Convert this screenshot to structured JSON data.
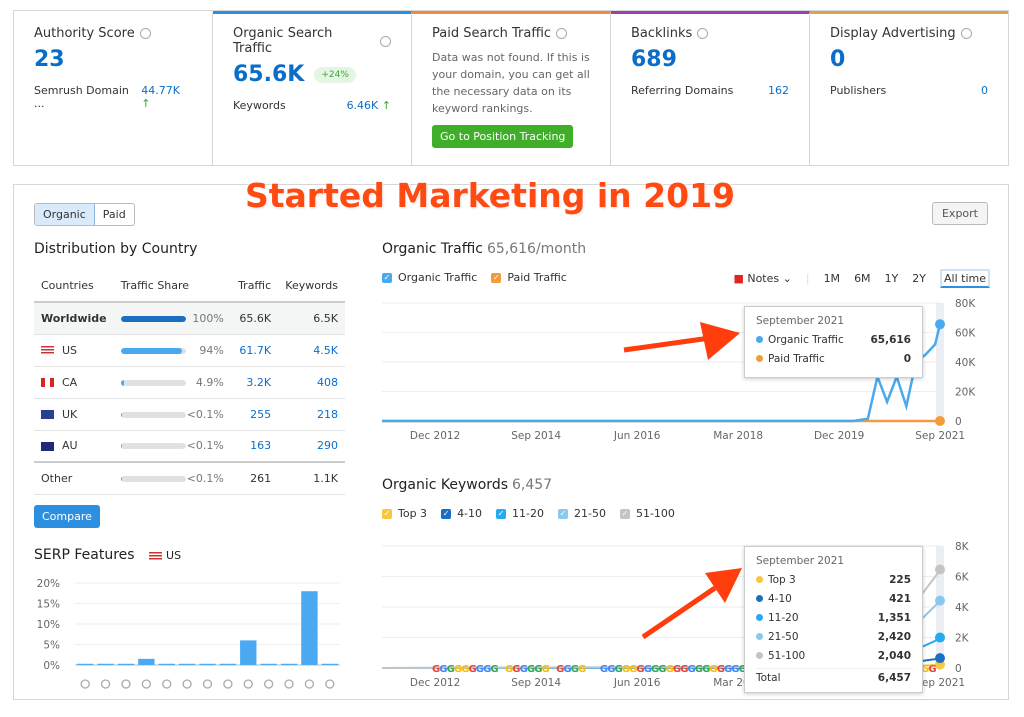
{
  "cards": [
    {
      "title": "Authority Score",
      "value": "23",
      "sub_label": "Semrush Domain ...",
      "sub_value": "44.77K",
      "accent": ""
    },
    {
      "title": "Organic Search Traffic",
      "value": "65.6K",
      "badge": "+24%",
      "sub_label": "Keywords",
      "sub_value": "6.46K",
      "accent": "#2d8fe0"
    },
    {
      "title": "Paid Search Traffic",
      "text": "Data was not found. If this is your domain, you can get all the necessary data on its keyword rankings.",
      "button": "Go to Position Tracking",
      "accent": "#f08a3c"
    },
    {
      "title": "Backlinks",
      "value": "689",
      "sub_label": "Referring Domains",
      "sub_value": "162",
      "accent": "#9b3fb5"
    },
    {
      "title": "Display Advertising",
      "value": "0",
      "sub_label": "Publishers",
      "sub_value": "0",
      "accent": "#d9a54a"
    }
  ],
  "headline": "Started Marketing in 2019",
  "toggle": {
    "organic": "Organic",
    "paid": "Paid"
  },
  "export_label": "Export",
  "distribution": {
    "title": "Distribution by Country",
    "headers": [
      "Countries",
      "Traffic Share",
      "Traffic",
      "Keywords"
    ],
    "rows": [
      {
        "country": "Worldwide",
        "share": 100,
        "share_label": "100%",
        "traffic": "65.6K",
        "keywords": "6.5K"
      },
      {
        "country": "US",
        "share": 94,
        "share_label": "94%",
        "traffic": "61.7K",
        "keywords": "4.5K"
      },
      {
        "country": "CA",
        "share": 4.9,
        "share_label": "4.9%",
        "traffic": "3.2K",
        "keywords": "408"
      },
      {
        "country": "UK",
        "share": 0.1,
        "share_label": "<0.1%",
        "traffic": "255",
        "keywords": "218"
      },
      {
        "country": "AU",
        "share": 0.1,
        "share_label": "<0.1%",
        "traffic": "163",
        "keywords": "290"
      },
      {
        "country": "Other",
        "share": 0.1,
        "share_label": "<0.1%",
        "traffic": "261",
        "keywords": "1.1K"
      }
    ],
    "compare_label": "Compare"
  },
  "serp": {
    "title": "SERP Features",
    "country": "US"
  },
  "traffic_header": {
    "title": "Organic Traffic",
    "value": "65,616/month",
    "legend": [
      "Organic Traffic",
      "Paid Traffic"
    ],
    "notes": "Notes",
    "ranges": [
      "1M",
      "6M",
      "1Y",
      "2Y",
      "All time"
    ],
    "selected_range": "All time"
  },
  "traffic_tooltip": {
    "date": "September 2021",
    "rows": [
      {
        "label": "Organic Traffic",
        "value": "65,616",
        "color": "#49a9ee"
      },
      {
        "label": "Paid Traffic",
        "value": "0",
        "color": "#f39a3a"
      }
    ]
  },
  "keywords_header": {
    "title": "Organic Keywords",
    "value": "6,457",
    "legend": [
      {
        "label": "Top 3",
        "color": "#f7c744"
      },
      {
        "label": "4-10",
        "color": "#1b6fc2"
      },
      {
        "label": "11-20",
        "color": "#26a9f0"
      },
      {
        "label": "21-50",
        "color": "#8cc7f2"
      },
      {
        "label": "51-100",
        "color": "#c4c4c4"
      }
    ]
  },
  "keywords_tooltip": {
    "date": "September 2021",
    "rows": [
      {
        "label": "Top 3",
        "value": "225",
        "color": "#f7c744"
      },
      {
        "label": "4-10",
        "value": "421",
        "color": "#1b6fc2"
      },
      {
        "label": "11-20",
        "value": "1,351",
        "color": "#26a9f0"
      },
      {
        "label": "21-50",
        "value": "2,420",
        "color": "#8cc7f2"
      },
      {
        "label": "51-100",
        "value": "2,040",
        "color": "#c4c4c4"
      }
    ],
    "total_label": "Total",
    "total": "6,457"
  },
  "chart_data": [
    {
      "type": "line",
      "title": "Organic Traffic",
      "x_ticks": [
        "Dec 2012",
        "Sep 2014",
        "Jun 2016",
        "Mar 2018",
        "Dec 2019",
        "Sep 2021"
      ],
      "y_ticks": [
        "0",
        "20K",
        "40K",
        "60K",
        "80K"
      ],
      "ylim": [
        0,
        80000
      ],
      "grid": true,
      "series": [
        {
          "name": "Organic Traffic",
          "color": "#49a9ee",
          "points": [
            [
              "2012-01",
              0
            ],
            [
              "2020-03",
              0
            ],
            [
              "2020-06",
              1500
            ],
            [
              "2020-08",
              30000
            ],
            [
              "2020-10",
              13000
            ],
            [
              "2020-12",
              30000
            ],
            [
              "2021-02",
              10000
            ],
            [
              "2021-04",
              40000
            ],
            [
              "2021-06",
              45000
            ],
            [
              "2021-08",
              52000
            ],
            [
              "2021-09",
              65616
            ]
          ]
        },
        {
          "name": "Paid Traffic",
          "color": "#f39a3a",
          "points": [
            [
              "2012-01",
              0
            ],
            [
              "2021-09",
              0
            ]
          ]
        }
      ]
    },
    {
      "type": "area",
      "title": "Organic Keywords",
      "stacked": true,
      "x_ticks": [
        "Dec 2012",
        "Sep 2014",
        "Jun 2016",
        "Mar 2018",
        "Dec 2019",
        "Sep 2021"
      ],
      "y_ticks": [
        "0",
        "2K",
        "4K",
        "6K",
        "8K"
      ],
      "ylim": [
        0,
        8000
      ],
      "grid": true,
      "x": [
        "2012-01",
        "2020-06",
        "2020-10",
        "2021-02",
        "2021-05",
        "2021-08",
        "2021-09"
      ],
      "series": [
        {
          "name": "Top 3",
          "values": [
            0,
            5,
            60,
            100,
            150,
            200,
            225
          ]
        },
        {
          "name": "4-10",
          "values": [
            0,
            10,
            120,
            200,
            300,
            380,
            421
          ]
        },
        {
          "name": "11-20",
          "values": [
            0,
            20,
            400,
            600,
            900,
            1200,
            1351
          ]
        },
        {
          "name": "21-50",
          "values": [
            0,
            30,
            800,
            1200,
            1800,
            2300,
            2420
          ]
        },
        {
          "name": "51-100",
          "values": [
            0,
            40,
            900,
            1300,
            1600,
            1900,
            2040
          ]
        }
      ]
    },
    {
      "type": "bar",
      "title": "SERP Features",
      "y_ticks": [
        "0%",
        "5%",
        "10%",
        "15%",
        "20%"
      ],
      "ylim": [
        0,
        20
      ],
      "categories": [
        "featured-snippet",
        "local-pack",
        "top-stories",
        "images",
        "sitelinks",
        "reviews",
        "video",
        "featured-video",
        "knowledge-panel",
        "image-pack",
        "video-carousel",
        "people-also-ask",
        "faq"
      ],
      "values": [
        0.3,
        0.3,
        0.3,
        1.5,
        0.3,
        0.3,
        0.3,
        0.3,
        6,
        0.3,
        0.3,
        18,
        0.3
      ]
    }
  ]
}
